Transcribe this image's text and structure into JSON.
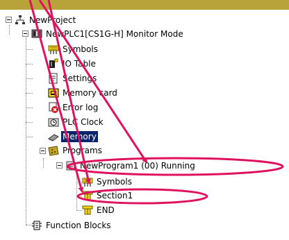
{
  "tree": {
    "project": "NewProject",
    "plc": "NewPLC1[CS1G-H] Monitor Mode",
    "symbols": "Symbols",
    "io_table": "IO Table",
    "settings": "Settings",
    "memory_card": "Memory card",
    "error_log": "Error log",
    "plc_clock": "PLC Clock",
    "memory": "Memory",
    "programs": "Programs",
    "program1": "NewProgram1 (00) Running",
    "program_symbols": "Symbols",
    "section1": "Section1",
    "end": "END",
    "function_blocks": "Function Blocks"
  },
  "colors": {
    "annotation": "#e0115f",
    "selection": "#0a246a",
    "topbar": "#b8a33a"
  },
  "icons": {
    "project": "network-icon",
    "plc": "plc-icon",
    "symbols": "symbols-icon",
    "io_table": "io-table-icon",
    "settings": "settings-icon",
    "memory_card": "memory-card-icon",
    "error_log": "error-log-icon",
    "plc_clock": "clock-icon",
    "memory": "memory-icon",
    "programs": "programs-icon",
    "program1": "program-icon",
    "section": "section-icon",
    "function_blocks": "function-block-icon"
  }
}
